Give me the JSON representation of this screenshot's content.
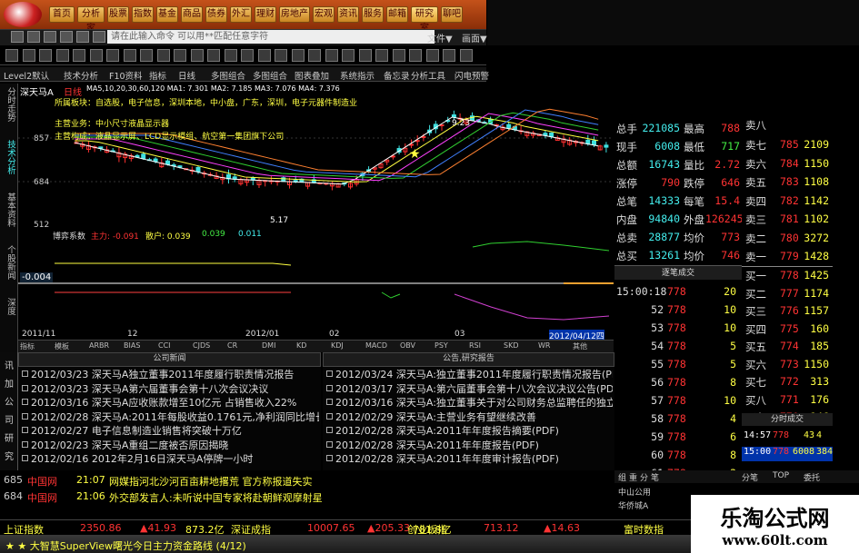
{
  "toolbar": {
    "buttons": [
      "首页",
      "分析家",
      "股票",
      "指数",
      "基金",
      "商品",
      "债券",
      "外汇",
      "理财",
      "房地产",
      "宏观",
      "资讯",
      "服务",
      "邮箱",
      "研究室",
      "聊吧"
    ],
    "command_placeholder": "请在此输入命令  可以用**匹配任意字符",
    "file_label": "文件▼",
    "draw_label": "画面▼"
  },
  "menu": [
    "Level2默认",
    "技术分析",
    "F10资料",
    "指标",
    "日线",
    "多图组合",
    "多图组合",
    "图表叠加",
    "系统指示",
    "备忘录",
    "分析工具",
    "闪电预警"
  ],
  "left_tabs": [
    "分时走势",
    "技术分析",
    "基本资料",
    "个股新闻",
    "深度"
  ],
  "stock": {
    "name": "深天马A",
    "period": "日线",
    "ma_line": "MA5,10,20,30,60,120 MA1: 7.301 MA2: 7.185 MA3: 7.076 MA4: 7.376",
    "tags": [
      "所属板块：自选股，电子信息，深圳本地，中小盘，广东，深圳，电子元器件制造业",
      "主营业务：中小尺寸液晶显示器",
      "主营构成：液晶显示屏、LCD显示模组、航空第一集团旗下公司"
    ],
    "price_labels": [
      "857",
      "684",
      "512"
    ],
    "callout_high": "9.23",
    "callout_low": "5.17"
  },
  "indicator": {
    "title": "博弈系数",
    "series_labels": [
      "主力: -0.091",
      "散户: 0.039",
      "0.039",
      "0.011"
    ],
    "left_value": "-0.004"
  },
  "dates": [
    "2011/11",
    "12",
    "2012/01",
    "02",
    "03",
    "2012/04/12四"
  ],
  "indicator_tabs": [
    "指标",
    "模板",
    "ARBR",
    "BIAS",
    "CCI",
    "CJDS",
    "CR",
    "DMI",
    "KD",
    "KDJ",
    "MACD",
    "OBV",
    "PSY",
    "RSI",
    "SKD",
    "WR",
    "其他"
  ],
  "quote": {
    "rows": [
      [
        "总手",
        "221085",
        "最高",
        "788"
      ],
      [
        "现手",
        "6008",
        "最低",
        "717"
      ],
      [
        "总额",
        "16743",
        "量比",
        "2.72"
      ],
      [
        "涨停",
        "790",
        "跌停",
        "646"
      ],
      [
        "总笔",
        "14333",
        "每笔",
        "15.4"
      ],
      [
        "内盘",
        "94840",
        "外盘",
        "126245"
      ],
      [
        "总卖",
        "28877",
        "均价",
        "773"
      ],
      [
        "总买",
        "13261",
        "均价",
        "746"
      ]
    ]
  },
  "orderbook": {
    "sells": [
      [
        "卖七",
        "785",
        "2109"
      ],
      [
        "卖六",
        "784",
        "1150"
      ],
      [
        "卖五",
        "783",
        "1108"
      ],
      [
        "卖四",
        "782",
        "1142"
      ],
      [
        "卖三",
        "781",
        "1102"
      ],
      [
        "卖二",
        "780",
        "3272"
      ],
      [
        "卖一",
        "779",
        "1428"
      ]
    ],
    "buys": [
      [
        "买一",
        "778",
        "1425"
      ],
      [
        "买二",
        "777",
        "1174"
      ],
      [
        "买三",
        "776",
        "1157"
      ],
      [
        "买四",
        "775",
        "160"
      ],
      [
        "买五",
        "774",
        "185"
      ],
      [
        "买六",
        "773",
        "1150"
      ],
      [
        "买七",
        "772",
        "313"
      ],
      [
        "买八",
        "771",
        "176"
      ],
      [
        "买九",
        "770",
        "146"
      ],
      [
        "买十",
        "769",
        "92"
      ]
    ],
    "top_label": "卖八"
  },
  "ticks": {
    "title": "逐笔成交",
    "rows": [
      [
        "15:00:18",
        "778",
        "20"
      ],
      [
        "52",
        "778",
        "10"
      ],
      [
        "53",
        "778",
        "10"
      ],
      [
        "54",
        "778",
        "5"
      ],
      [
        "55",
        "778",
        "5"
      ],
      [
        "56",
        "778",
        "8"
      ],
      [
        "57",
        "778",
        "10"
      ],
      [
        "58",
        "778",
        "4"
      ],
      [
        "59",
        "778",
        "6"
      ],
      [
        "60",
        "778",
        "8"
      ],
      [
        "61",
        "778",
        "3"
      ]
    ]
  },
  "fenshi": {
    "title": "分时成交",
    "rows": [
      [
        "14:57",
        "778",
        "43",
        "4"
      ],
      [
        "15:00",
        "778",
        "6008",
        "384"
      ]
    ]
  },
  "news_left": {
    "title": "公司新闻",
    "items": [
      "2012/03/23 深天马A独立董事2011年度履行职责情况报告",
      "2012/03/23 深天马A第六届董事会第十八次会议决议",
      "2012/03/16 深天马A应收账款增至10亿元 占销售收入22%",
      "2012/02/28 深天马A:2011年每股收益0.1761元,净利润同比增长43.",
      "2012/02/27 电子信息制造业销售将突破十万亿",
      "2012/02/23 深天马A重组二度被否原因揭晓",
      "2012/02/16 2012年2月16日深天马A停牌一小时"
    ]
  },
  "news_right": {
    "title": "公告,研究报告",
    "items": [
      "2012/03/24 深天马A:独立董事2011年度履行职责情况报告(PDF)",
      "2012/03/17 深天马A:第六届董事会第十八次会议决议公告(PDF)",
      "2012/03/16 深天马A:独立董事关于对公司财务总监聘任的独立",
      "2012/02/29 深天马A:主营业务有望继续改善",
      "2012/02/28 深天马A:2011年年度报告摘要(PDF)",
      "2012/02/28 深天马A:2011年年度报告(PDF)",
      "2012/02/28 深天马A:2011年年度审计报告(PDF)"
    ]
  },
  "news_side_tabs": [
    "讯",
    "加",
    "公",
    "司",
    "研",
    "究"
  ],
  "alerts": [
    {
      "code": "685",
      "src": "中国网",
      "time": "21:07",
      "text": "网媒指河北沙河百亩耕地撂荒 官方称报道失实"
    },
    {
      "code": "684",
      "src": "中国网",
      "time": "21:06",
      "text": "外交部发言人:未听说中国专家将赴朝鲜观摩射星"
    }
  ],
  "bottom_tabs": [
    "组",
    "重",
    "分",
    "笔",
    "分笔",
    "TOP",
    "委托"
  ],
  "bottom_right_rows": [
    "中山公用",
    "华侨城A"
  ],
  "indexbar": [
    {
      "name": "上证指数",
      "value": "2350.86",
      "change": "▲41.93",
      "amount": "873.2亿"
    },
    {
      "name": "深证成指",
      "value": "10007.65",
      "change": "▲205.33",
      "amount": "781.8亿"
    },
    {
      "name": "创业板指",
      "value": "713.12",
      "change": "▲14.63",
      "amount": ""
    },
    {
      "name": "富时数指",
      "value": "",
      "change": "",
      "amount": ""
    }
  ],
  "status": "★ ★ 大智慧SuperView曙光今日主力资金路线 (4/12)",
  "watermark": {
    "line1": "乐淘公式网",
    "line2": "www.60lt.com"
  },
  "colors": {
    "red": "#ff3030",
    "green": "#30d030",
    "yellow": "#ffff40",
    "cyan": "#40e0e0",
    "orange": "#f2a030"
  }
}
